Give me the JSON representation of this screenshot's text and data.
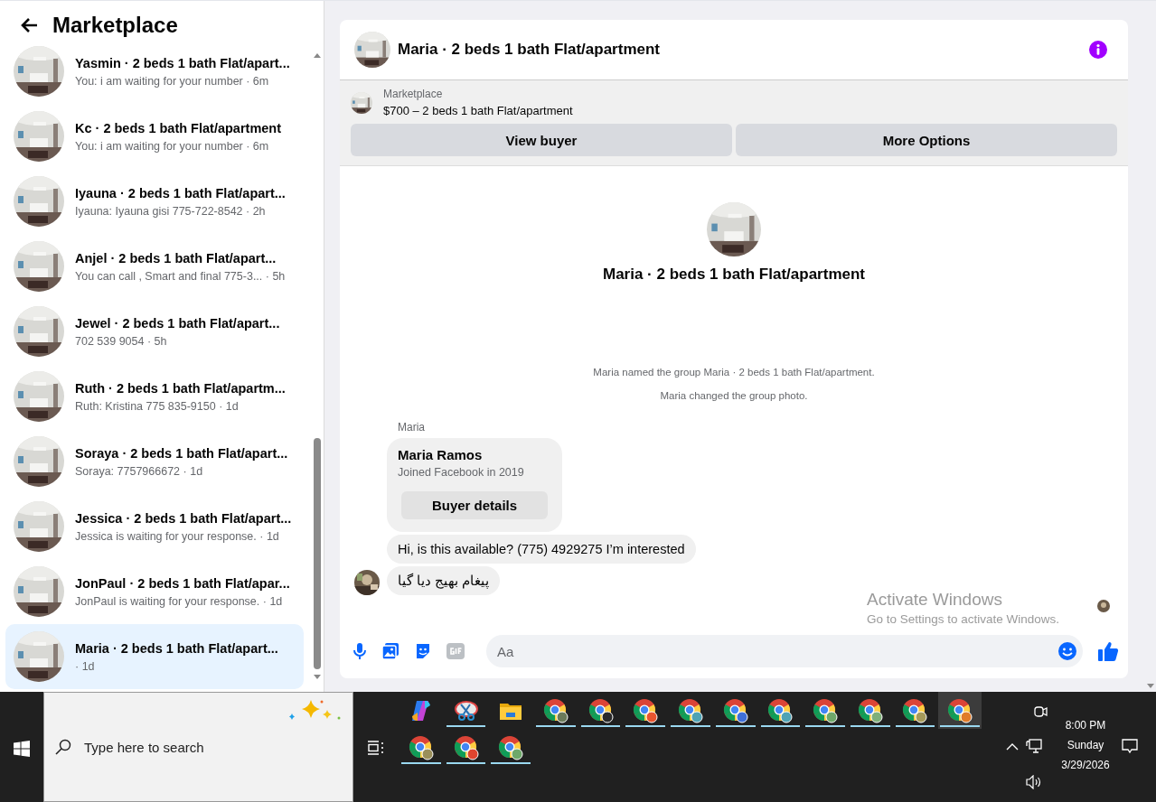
{
  "sidebar": {
    "title": "Marketplace",
    "conversations": [
      {
        "title": "Yasmin · 2 beds 1 bath Flat/apart...",
        "preview": "You: i am waiting for your number · 6m",
        "selected": false
      },
      {
        "title": "Kc · 2 beds 1 bath Flat/apartment",
        "preview": "You: i am waiting for your number · 6m",
        "selected": false
      },
      {
        "title": "Iyauna · 2 beds 1 bath Flat/apart...",
        "preview": "Iyauna: Iyauna gisi 775-722-8542 · 2h",
        "selected": false
      },
      {
        "title": "Anjel · 2 beds 1 bath Flat/apart...",
        "preview": "You can call , Smart and final 775-3...  · 5h",
        "selected": false
      },
      {
        "title": "Jewel · 2 beds 1 bath Flat/apart...",
        "preview": "702 539 9054 · 5h",
        "selected": false
      },
      {
        "title": "Ruth · 2 beds 1 bath Flat/apartm...",
        "preview": "Ruth: Kristina 775 835-9150 · 1d",
        "selected": false
      },
      {
        "title": "Soraya · 2 beds 1 bath Flat/apart...",
        "preview": "Soraya: 7757966672 · 1d",
        "selected": false
      },
      {
        "title": "Jessica · 2 beds 1 bath Flat/apart...",
        "preview": "Jessica is waiting for your response. · 1d",
        "selected": false
      },
      {
        "title": "JonPaul · 2 beds 1 bath Flat/apar...",
        "preview": "JonPaul is waiting for your response. · 1d",
        "selected": false
      },
      {
        "title": "Maria · 2 beds 1 bath Flat/apart...",
        "preview": "· 1d",
        "selected": true
      }
    ]
  },
  "chat": {
    "title": "Maria · 2 beds 1 bath Flat/apartment",
    "listing": {
      "source": "Marketplace",
      "summary": "$700 – 2 beds 1 bath Flat/apartment",
      "buttons": [
        "View buyer",
        "More Options"
      ]
    },
    "intro_title": "Maria · 2 beds 1 bath Flat/apartment",
    "events": [
      "Maria named the group Maria · 2 beds 1 bath Flat/apartment.",
      "Maria changed the group photo."
    ],
    "sender": "Maria",
    "messages": [
      {
        "kind": "profile-card",
        "name": "Maria Ramos",
        "subtitle": "Joined Facebook in 2019",
        "button": "Buyer details"
      },
      {
        "kind": "text",
        "text": "Hi, is this available? (775) 4929275 I’m interested"
      },
      {
        "kind": "text",
        "text": "پیغام بھیج دیا گیا"
      }
    ],
    "composer": {
      "placeholder": "Aa"
    }
  },
  "os_notice": {
    "title": "Activate Windows",
    "subtitle": "Go to Settings to activate Windows."
  },
  "taskbar": {
    "search_placeholder": "Type here to search",
    "apps": [
      {
        "kind": "copilot",
        "running": false,
        "selected": false
      },
      {
        "kind": "snipping",
        "running": true,
        "selected": false
      },
      {
        "kind": "folder",
        "running": false,
        "selected": false
      },
      {
        "kind": "chrome",
        "color": "#6b7a5a",
        "running": true,
        "selected": false
      },
      {
        "kind": "chrome",
        "color": "#2a2a2a",
        "running": true,
        "selected": false
      },
      {
        "kind": "chrome",
        "color": "#e8552f",
        "running": true,
        "selected": false
      },
      {
        "kind": "chrome",
        "color": "#4fa3b5",
        "running": true,
        "selected": false
      },
      {
        "kind": "chrome",
        "color": "#3f6fd8",
        "running": true,
        "selected": false
      },
      {
        "kind": "chrome",
        "color": "#4fa3b5",
        "running": true,
        "selected": false
      },
      {
        "kind": "chrome",
        "color": "#6ea86a",
        "running": true,
        "selected": false
      },
      {
        "kind": "chrome",
        "color": "#7fb07a",
        "running": true,
        "selected": false
      },
      {
        "kind": "chrome",
        "color": "#a59a5a",
        "running": true,
        "selected": false
      },
      {
        "kind": "chrome",
        "color": "#e07b2a",
        "running": true,
        "selected": true
      },
      {
        "kind": "chrome",
        "color": "#9a8f5a",
        "running": true,
        "selected": false
      },
      {
        "kind": "chrome",
        "color": "#e0452f",
        "running": true,
        "selected": false
      },
      {
        "kind": "chrome",
        "color": "#6ea86a",
        "running": true,
        "selected": false
      }
    ],
    "clock": {
      "time": "8:00 PM",
      "day": "Sunday",
      "date": "3/29/2026"
    }
  }
}
